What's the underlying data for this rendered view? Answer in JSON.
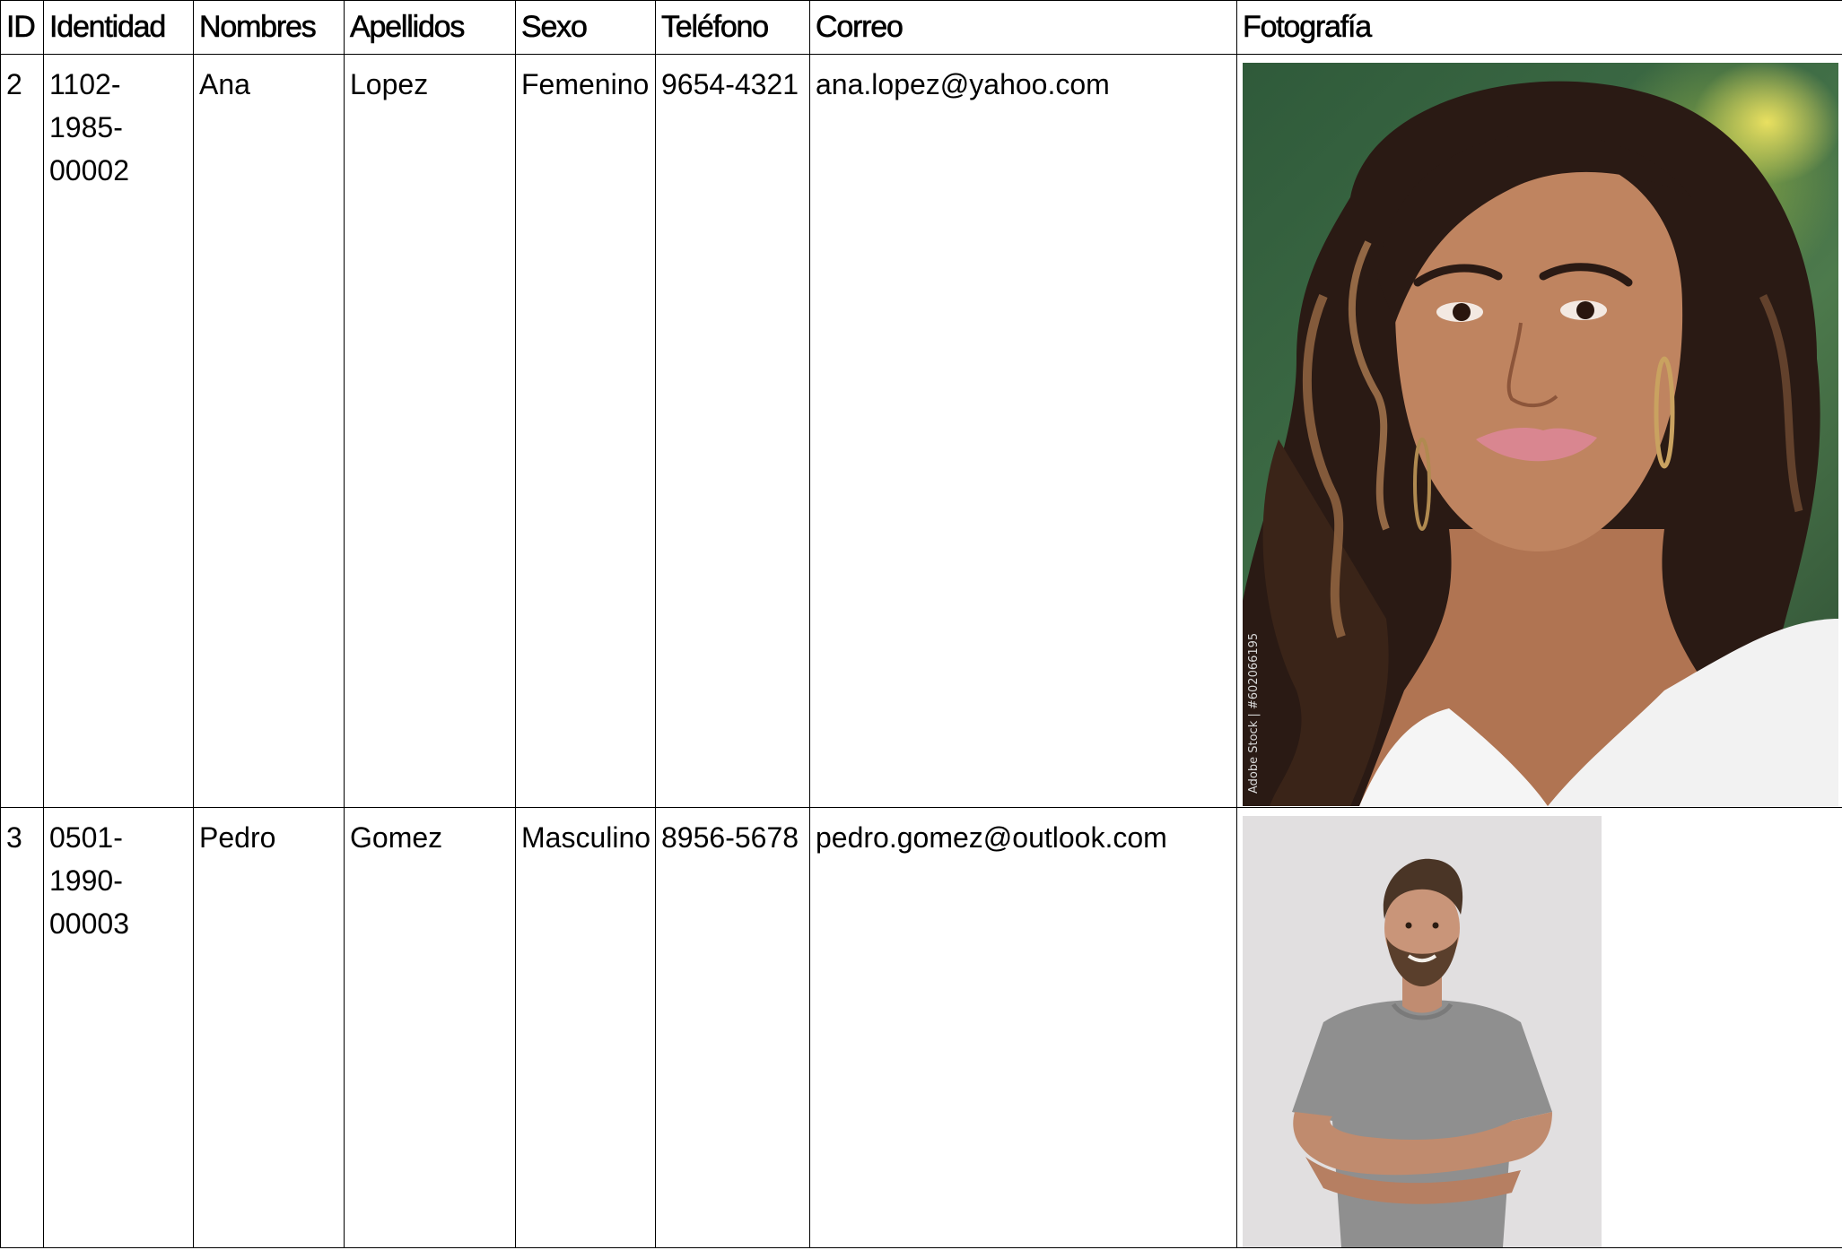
{
  "table": {
    "headers": {
      "id": "ID",
      "identidad": "Identidad",
      "nombres": "Nombres",
      "apellidos": "Apellidos",
      "sexo": "Sexo",
      "telefono": "Teléfono",
      "correo": "Correo",
      "fotografia": "Fotografía"
    },
    "rows": [
      {
        "id": "2",
        "identidad_lines": [
          "1102-",
          "1985-",
          "00002"
        ],
        "nombres": "Ana",
        "apellidos": "Lopez",
        "sexo": "Femenino",
        "telefono": "9654-4321",
        "correo": "ana.lopez@yahoo.com",
        "photo": {
          "subject": "portrait-woman-curly-hair",
          "watermark": "Adobe Stock | #602066195",
          "colors": {
            "background": "#3d6b45",
            "hair": "#2a1a14",
            "skin": "#b87a58",
            "top": "#f4f4f4"
          }
        }
      },
      {
        "id": "3",
        "identidad_lines": [
          "0501-",
          "1990-",
          "00003"
        ],
        "nombres": "Pedro",
        "apellidos": "Gomez",
        "sexo": "Masculino",
        "telefono": "8956-5678",
        "correo": "pedro.gomez@outlook.com",
        "photo": {
          "subject": "man-gray-tshirt-arms-crossed",
          "colors": {
            "background": "#e1dfe0",
            "shirt": "#8e8e8e",
            "skin": "#c59277",
            "hair": "#4a3526"
          }
        }
      }
    ]
  }
}
